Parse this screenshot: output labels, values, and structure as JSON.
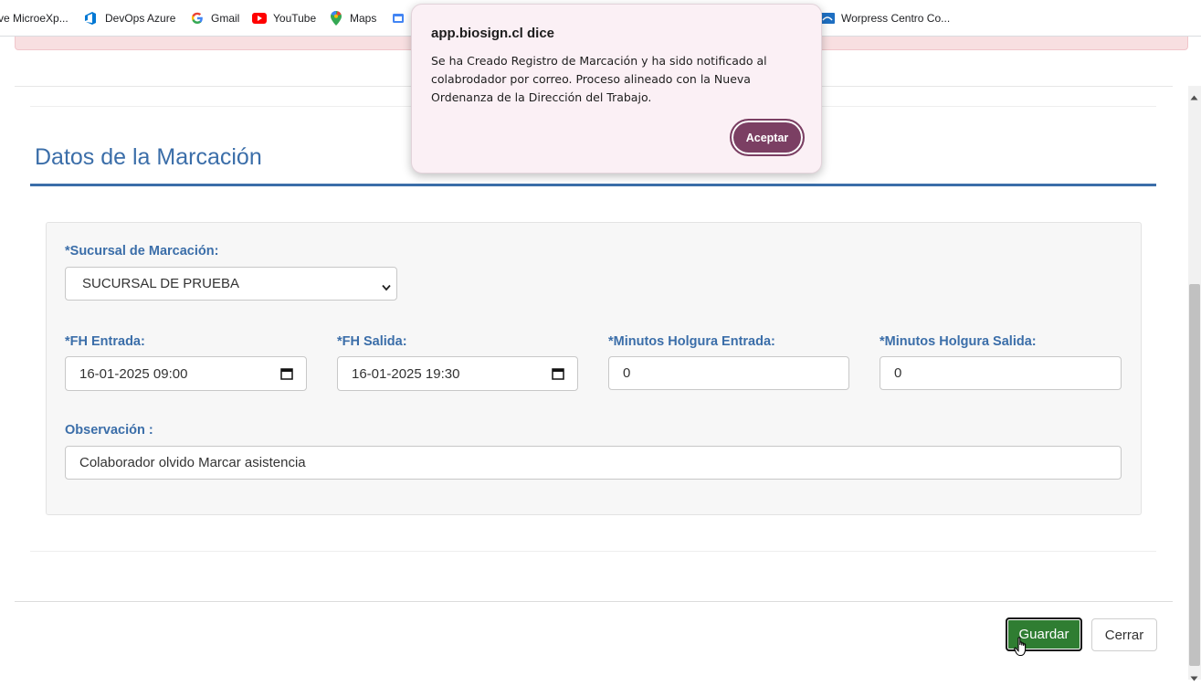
{
  "bookmarks": [
    {
      "label": "ve MicroeXp...",
      "icon": "none"
    },
    {
      "label": "DevOps Azure",
      "icon": "azure-devops-icon"
    },
    {
      "label": "Gmail",
      "icon": "google-icon"
    },
    {
      "label": "YouTube",
      "icon": "youtube-icon"
    },
    {
      "label": "Maps",
      "icon": "maps-pin-icon"
    },
    {
      "label": "",
      "icon": "app-icon"
    },
    {
      "label": "Worpress Centro Co...",
      "icon": "wordpress-site-icon"
    }
  ],
  "section": {
    "title": "Datos de la Marcación"
  },
  "form": {
    "sucursal_label": "*Sucursal de Marcación:",
    "sucursal_value": "SUCURSAL DE PRUEBA",
    "fh_entrada_label": "*FH Entrada:",
    "fh_entrada_value": "16-01-2025 09:00",
    "fh_salida_label": "*FH Salida:",
    "fh_salida_value": "16-01-2025 19:30",
    "holgura_entrada_label": "*Minutos Holgura Entrada:",
    "holgura_entrada_value": "0",
    "holgura_salida_label": "*Minutos Holgura Salida:",
    "holgura_salida_value": "0",
    "observacion_label": "Observación :",
    "observacion_value": "Colaborador olvido Marcar asistencia"
  },
  "footer": {
    "save_label": "Guardar",
    "close_label": "Cerrar"
  },
  "dialog": {
    "title": "app.biosign.cl dice",
    "message": "Se ha Creado Registro de Marcación y ha sido notificado al colabrodador por correo. Proceso alineado con la Nueva Ordenanza de la Dirección del Trabajo.",
    "accept_label": "Aceptar"
  },
  "colors": {
    "accent": "#3b6ea9",
    "save_button": "#2f7d32",
    "dialog_button": "#7b3f63",
    "alert_strip": "#f8dfe1"
  }
}
